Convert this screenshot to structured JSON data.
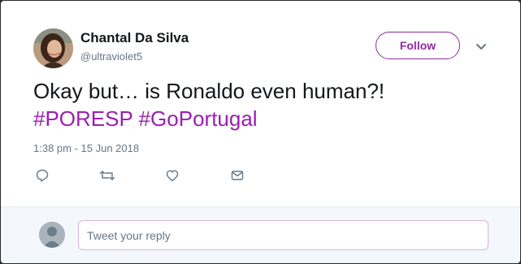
{
  "user": {
    "display_name": "Chantal Da Silva",
    "handle": "@ultraviolet5"
  },
  "follow_button": {
    "label": "Follow"
  },
  "tweet": {
    "text": "Okay but… is Ronaldo even human?!",
    "hashtags": [
      "#PORESP",
      "#GoPortugal"
    ],
    "timestamp": "1:38 pm - 15 Jun 2018"
  },
  "actions": [
    "reply-icon",
    "retweet-icon",
    "like-icon",
    "message-icon"
  ],
  "reply": {
    "placeholder": "Tweet your reply"
  },
  "colors": {
    "accent": "#9a1fb0",
    "follow_border": "#8e2a9e",
    "text_primary": "#14171a",
    "text_secondary": "#657786"
  }
}
